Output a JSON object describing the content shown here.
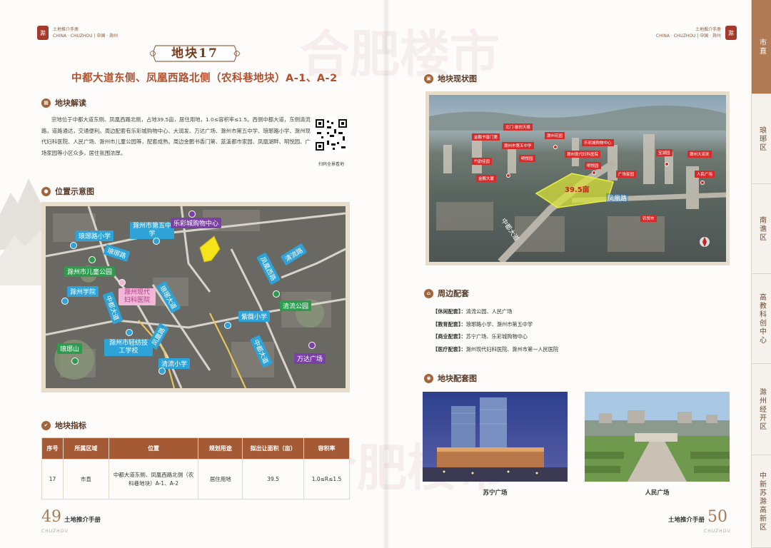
{
  "header": {
    "left": {
      "title": "土地推介手册",
      "subtitle": "CHINA · CHUZHOU | 中国 · 滁州",
      "seal": "滁"
    },
    "right": {
      "title": "土地推介手册",
      "subtitle": "CHINA · CHUZHOU | 中国 · 滁州",
      "seal": "滁"
    }
  },
  "plot_banner": "地块17",
  "main_title": "中都大道东侧、凤凰西路北侧（农科巷地块）A-1、A-2",
  "sections": {
    "interpretation": {
      "title": "地块解读"
    },
    "location": {
      "title": "位置示意图"
    },
    "indicators": {
      "title": "地块指标"
    },
    "status": {
      "title": "地块现状图"
    },
    "amenities": {
      "title": "周边配套"
    },
    "amenity_photos": {
      "title": "地块配套图"
    }
  },
  "description": "宗地位于中都大道东侧、凤凰西路北侧，占地39.5亩，居住用地，1.0≤容积率≤1.5。西侧中都大道，东侧清流路，道路通达，交通便利。周边配套有乐彩城购物中心、大润发、万达广场、滁州市第五中学、琅琊路小学、滁州现代妇科医院、人民广场、滁州市儿童公园等，配套成熟。周边金鹏书香门第、蓝溪都市家园、凤凰湖畔、明悦园、广场家园等小区众多，居住氛围浓厚。",
  "qr_caption": "扫码全景看地",
  "map_labels": {
    "langyalu_school": "琅琊路小学",
    "fifth_middle": "滁州市第五中学",
    "lecai": "乐彩城购物中心",
    "langyalu": "琅琊路",
    "qingliu_road": "清流路",
    "childrens_park": "滁州市儿童公园",
    "fenghuang_west": "凤凰西路",
    "chuzhou_college": "滁州学院",
    "modern_hospital": "滁州现代妇科医院",
    "zhongdu_road": "中都大道",
    "langya_ave": "琅琊大道",
    "ziwei_school": "紫薇小学",
    "qingliu_park": "清流公园",
    "langya_mountain": "琅琊山",
    "light_textile": "滁州市轻纺技工学校",
    "fenghuang_road": "凤凰路",
    "wanda": "万达广场",
    "qingliu_school": "清流小学",
    "zhongdu_ave2": "中都大道"
  },
  "table": {
    "headers": [
      "序号",
      "所属区域",
      "位置",
      "规划用途",
      "拟出让面积（亩）",
      "容积率"
    ],
    "rows": [
      [
        "17",
        "市直",
        "中都大道东侧、凤凰西路北侧（农科巷地块）A-1、A-2",
        "居住用地",
        "39.5",
        "1.0≤R≤1.5"
      ]
    ]
  },
  "photo_tags": {
    "area": "39.5亩",
    "road_east": "凤凰路",
    "road_west": "中都大道",
    "tag1": "金鹏书香门第",
    "tag2": "北门·融创天禧",
    "tag3": "滁州市第五中学",
    "tag4": "滁州花园",
    "tag5": "乐彩城购物中心",
    "tag6": "竹韵佳园",
    "tag7": "明悦园",
    "tag8": "滁州现代妇科医院",
    "tag9": "明悦园",
    "tag10": "金鹏大厦",
    "tag11": "广场家园",
    "tag12": "宝湖园",
    "tag13": "滁州大润发",
    "tag14": "人民广场",
    "tag15": "农贸市"
  },
  "amenities": [
    {
      "label": "【休闲配套】：",
      "value": "清流公园、人民广场"
    },
    {
      "label": "【教育配套】：",
      "value": "琅琊路小学、滁州市第五中学"
    },
    {
      "label": "【商业配套】：",
      "value": "苏宁广场、乐彩城购物中心"
    },
    {
      "label": "【医疗配套】：",
      "value": "滁州现代妇科医院、滁州市第一人民医院"
    }
  ],
  "photos": [
    {
      "caption": "苏宁广场"
    },
    {
      "caption": "人民广场"
    }
  ],
  "footer": {
    "left": {
      "num": "49",
      "title": "土地推介手册",
      "sub": "CHUZHOU"
    },
    "right": {
      "num": "50",
      "title": "土地推介手册",
      "sub": "CHUZHOU"
    }
  },
  "watermark": "合肥楼市",
  "tabs": [
    {
      "label": "市直",
      "active": true
    },
    {
      "label": "琅琊区",
      "active": false
    },
    {
      "label": "南谯区",
      "active": false
    },
    {
      "label": "高教科创中心",
      "active": false
    },
    {
      "label": "滁州经开区",
      "active": false
    },
    {
      "label": "中新苏滁高新区",
      "active": false
    }
  ],
  "colors": {
    "accent": "#a45a35",
    "title_red": "#b0502f",
    "tab_active": "#b07a55"
  }
}
